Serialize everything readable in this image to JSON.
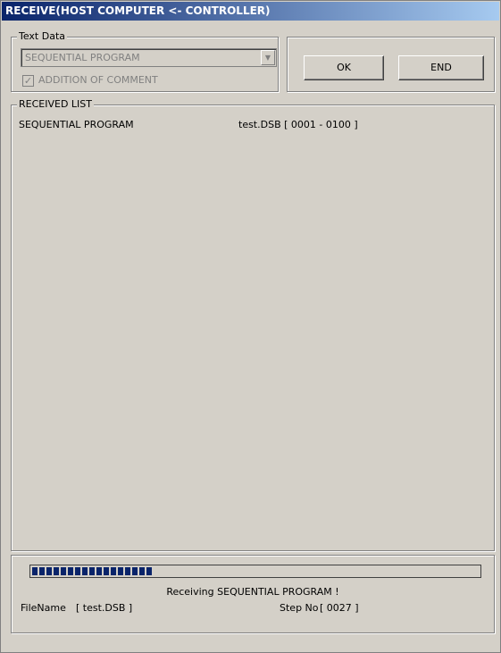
{
  "window": {
    "title": "RECEIVE(HOST COMPUTER <- CONTROLLER)"
  },
  "text_data": {
    "label": "Text Data",
    "combo_value": "SEQUENTIAL PROGRAM",
    "combo_arrow_icon": "chevron-down-icon",
    "checkbox_label": "ADDITION OF COMMENT",
    "checkbox_checked": true
  },
  "buttons": {
    "ok": "OK",
    "end": "END"
  },
  "received_list": {
    "label": "RECEIVED LIST",
    "rows": [
      {
        "name": "SEQUENTIAL PROGRAM",
        "detail": "test.DSB [ 0001 - 0100 ]"
      }
    ]
  },
  "progress": {
    "fraction": 0.27,
    "status_text": "Receiving SEQUENTIAL PROGRAM !",
    "filename_label": "FileName",
    "filename_value": "[ test.DSB ]",
    "step_label": "Step No",
    "step_value": "[ 0027 ]"
  }
}
